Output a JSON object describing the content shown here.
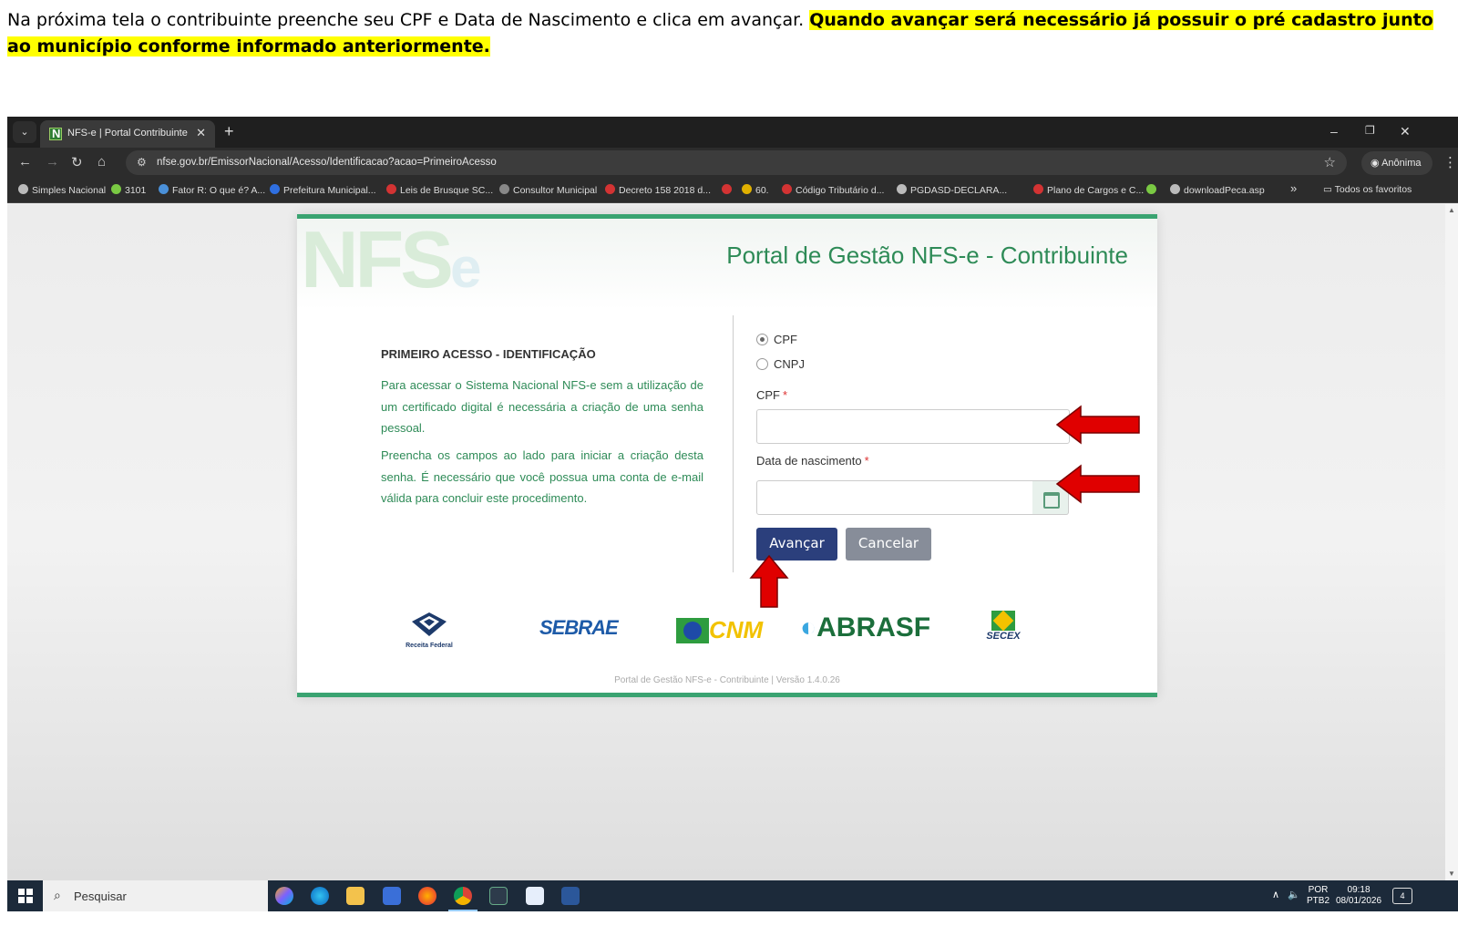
{
  "instruction": {
    "plain": "Na próxima tela o contribuinte preenche seu CPF e Data de Nascimento e clica em avançar. ",
    "highlight": "Quando avançar será necessário já possuir o pré cadastro junto ao município conforme informado anteriormente."
  },
  "browser": {
    "tab_title": "NFS-e | Portal Contribuinte",
    "url": "nfse.gov.br/EmissorNacional/Acesso/Identificacao?acao=PrimeiroAcesso",
    "profile_label": "Anônima",
    "bookmarks": [
      {
        "label": "Simples Nacional",
        "color": "#bbbbbb"
      },
      {
        "label": "3101",
        "color": "#7ac943"
      },
      {
        "label": "Fator R: O que é? A...",
        "color": "#4a90d9"
      },
      {
        "label": "Prefeitura Municipal...",
        "color": "#2f6fe0"
      },
      {
        "label": "Leis de Brusque SC...",
        "color": "#d33333"
      },
      {
        "label": "Consultor Municipal",
        "color": "#888888"
      },
      {
        "label": "Decreto 158 2018 d...",
        "color": "#d33333"
      },
      {
        "label": "",
        "color": "#d33333"
      },
      {
        "label": "60.",
        "color": "#e0b000"
      },
      {
        "label": "Código Tributário d...",
        "color": "#d33333"
      },
      {
        "label": "PGDASD-DECLARA...",
        "color": "#bbbbbb"
      },
      {
        "label": "Plano de Cargos e C...",
        "color": "#d33333"
      },
      {
        "label": "",
        "color": "#7ac943"
      },
      {
        "label": "downloadPeca.asp",
        "color": "#bbbbbb"
      }
    ],
    "all_bookmarks_label": "Todos os favoritos"
  },
  "portal": {
    "title": "Portal de Gestão NFS-e - Contribuinte",
    "watermark": "NFS",
    "watermark_e": "e",
    "section_title": "PRIMEIRO ACESSO - IDENTIFICAÇÃO",
    "paragraph1": "Para acessar o Sistema Nacional NFS-e sem a utilização de um certificado digital é necessária a criação de uma senha pessoal.",
    "paragraph2": "Preencha os campos ao lado para iniciar a criação desta senha. É necessário que você possua uma conta de e-mail válida para concluir este procedimento.",
    "radio_cpf": "CPF",
    "radio_cnpj": "CNPJ",
    "cpf_label": "CPF",
    "cpf_value": "",
    "birth_label": "Data de nascimento",
    "birth_value": "",
    "required_mark": "*",
    "btn_next": "Avançar",
    "btn_cancel": "Cancelar",
    "logos": {
      "receita": "Receita Federal",
      "sebrae": "SEBRAE",
      "cnm": "CNM",
      "abrasf": "ABRASF",
      "secex": "SECEX"
    },
    "footer": "Portal de Gestão NFS-e - Contribuinte | Versão 1.4.0.26"
  },
  "taskbar": {
    "search_placeholder": "Pesquisar",
    "lang1": "POR",
    "lang2": "PTB2",
    "time": "09:18",
    "date": "08/01/2026",
    "notif": "4"
  },
  "colors": {
    "accent_green": "#2e8b57",
    "primary_button": "#2b3f7c",
    "highlight": "#ffff00",
    "arrow_red": "#e00000"
  }
}
